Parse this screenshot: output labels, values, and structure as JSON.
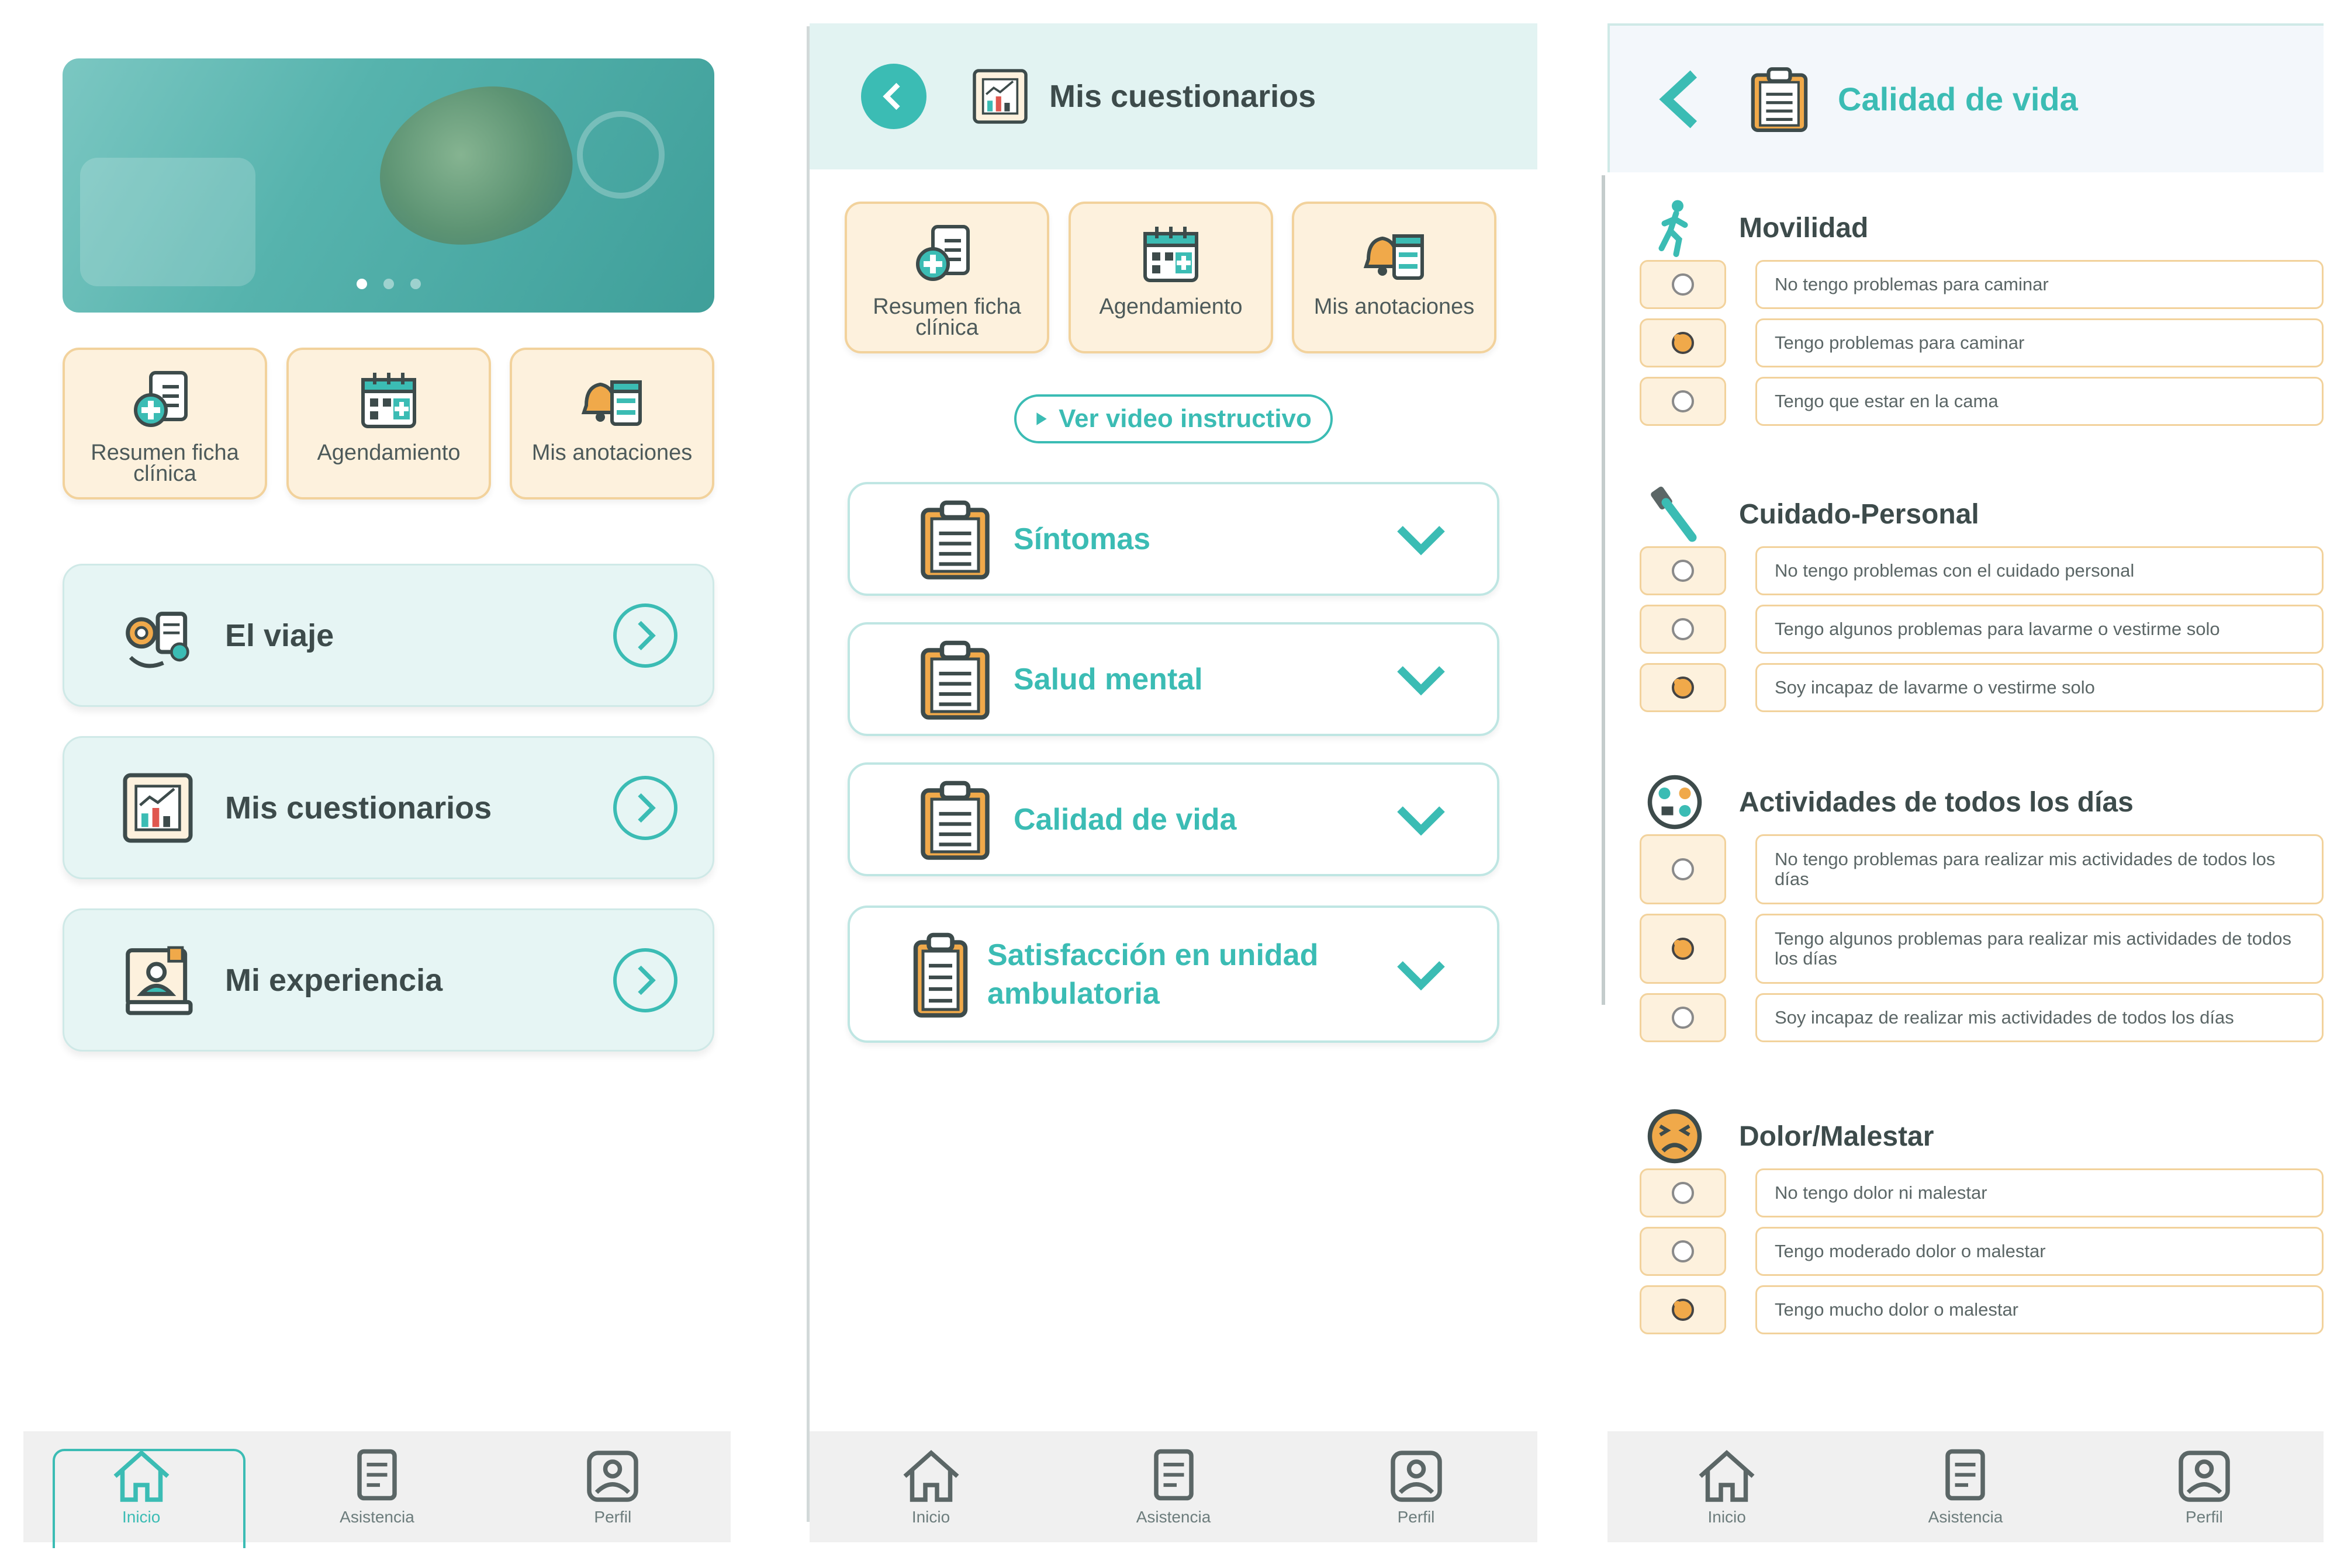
{
  "colors": {
    "accent": "#3bbcb4",
    "card_warm_bg": "#fdf1dd",
    "card_warm_border": "#f2d29c",
    "card_teal_bg": "#e6f5f4",
    "selected_radio": "#f0a94a"
  },
  "quick_access": [
    {
      "label": "Resumen ficha clínica",
      "icon": "clinical-record-icon"
    },
    {
      "label": "Agendamiento",
      "icon": "calendar-icon"
    },
    {
      "label": "Mis anotaciones",
      "icon": "notes-icon"
    }
  ],
  "screen1": {
    "carousel": {
      "slides": 3,
      "active_slide": 1
    },
    "nav_cards": [
      {
        "title": "El viaje",
        "icon": "journey-icon"
      },
      {
        "title": "Mis cuestionarios",
        "icon": "chart-board-icon"
      },
      {
        "title": "Mi experiencia",
        "icon": "experience-icon"
      }
    ]
  },
  "screen2": {
    "header_title": "Mis cuestionarios",
    "video_link": "Ver video instructivo",
    "questionnaires": [
      {
        "title": "Síntomas"
      },
      {
        "title": "Salud mental"
      },
      {
        "title": "Calidad de vida"
      },
      {
        "title": "Satisfacción en unidad ambulatoria"
      }
    ]
  },
  "screen3": {
    "header_title": "Calidad de vida",
    "sections": [
      {
        "title": "Movilidad",
        "icon": "walking-person-icon",
        "options": [
          "No tengo problemas para caminar",
          "Tengo problemas para caminar",
          "Tengo que estar en la cama"
        ],
        "selected": 1
      },
      {
        "title": "Cuidado-Personal",
        "icon": "toothbrush-icon",
        "options": [
          "No tengo problemas con el cuidado personal",
          "Tengo algunos problemas para lavarme o vestirme solo",
          "Soy incapaz de lavarme o vestirme solo"
        ],
        "selected": 2
      },
      {
        "title": "Actividades de todos los días",
        "icon": "daily-activities-icon",
        "options": [
          "No tengo problemas para realizar mis actividades de todos los días",
          "Tengo algunos problemas para realizar mis actividades de todos los días",
          "Soy incapaz de realizar mis actividades de todos los días"
        ],
        "selected": 1
      },
      {
        "title": "Dolor/Malestar",
        "icon": "pain-face-icon",
        "options": [
          "No tengo dolor ni malestar",
          "Tengo moderado dolor o malestar",
          "Tengo mucho dolor o malestar"
        ],
        "selected": 2
      }
    ]
  },
  "bottom_nav": [
    {
      "label": "Inicio",
      "icon": "home-icon"
    },
    {
      "label": "Asistencia",
      "icon": "assistance-document-icon"
    },
    {
      "label": "Perfil",
      "icon": "profile-icon"
    }
  ]
}
